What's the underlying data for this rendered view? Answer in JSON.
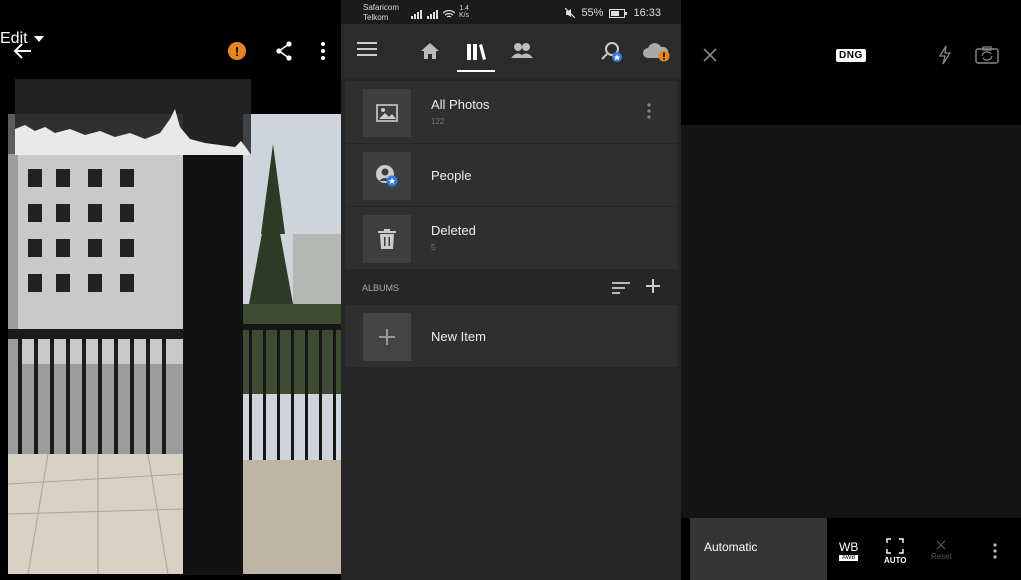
{
  "left_panel": {
    "edit_label": "Edit",
    "alert_symbol": "!"
  },
  "middle_panel": {
    "status": {
      "carrier1": "Safaricom",
      "carrier2": "Telkom",
      "speed_value": "1.4",
      "speed_unit": "K/s",
      "battery": "55%",
      "time": "16:33"
    },
    "library": [
      {
        "title": "All Photos",
        "count": "122"
      },
      {
        "title": "People",
        "count": ""
      },
      {
        "title": "Deleted",
        "count": "5"
      }
    ],
    "albums_label": "ALBUMS",
    "new_item_label": "New Item"
  },
  "right_panel": {
    "format_badge": "DNG",
    "mode_label": "Automatic",
    "wb_label": "WB",
    "wb_sub": "AWB",
    "auto_label": "AUTO",
    "reset_label": "Reset"
  },
  "colors": {
    "accent_orange": "#e6871e",
    "accent_blue": "#2d7be5",
    "panel_dark": "#262626",
    "item_bg": "#2f2f2f"
  }
}
